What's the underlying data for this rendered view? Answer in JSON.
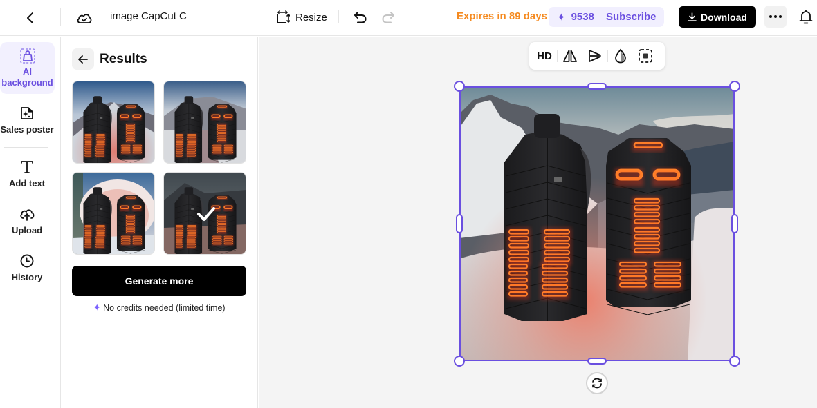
{
  "topbar": {
    "title": "image CapCut C",
    "resize_label": "Resize",
    "expires": "Expires in 89 days",
    "credits": "9538",
    "subscribe": "Subscribe",
    "download": "Download"
  },
  "colors": {
    "accent": "#6a4fe0",
    "expires": "#f58a1f",
    "primary_button": "#000000"
  },
  "sidebar": {
    "items": [
      {
        "label": "AI background",
        "icon": "shopping-bag-icon",
        "active": true
      },
      {
        "label": "Sales poster",
        "icon": "poster-icon"
      },
      {
        "label": "Add text",
        "icon": "text-icon"
      },
      {
        "label": "Upload",
        "icon": "upload-cloud-icon"
      },
      {
        "label": "History",
        "icon": "clock-icon"
      }
    ]
  },
  "panel": {
    "title": "Results",
    "results": [
      {
        "name": "result-1",
        "scene": "mountain-road-red-glow",
        "selected": false
      },
      {
        "name": "result-2",
        "scene": "snowy-mountain-road",
        "selected": false
      },
      {
        "name": "result-3",
        "scene": "snow-cave-forest",
        "selected": false
      },
      {
        "name": "result-4",
        "scene": "mountain-snow-dusk",
        "selected": true
      }
    ],
    "generate_more": "Generate more",
    "note": "No credits needed (limited time)"
  },
  "floating_toolbar": {
    "hd_label": "HD",
    "tools": [
      "flip-horizontal-icon",
      "flip-vertical-icon",
      "opacity-icon",
      "cutout-icon"
    ]
  }
}
